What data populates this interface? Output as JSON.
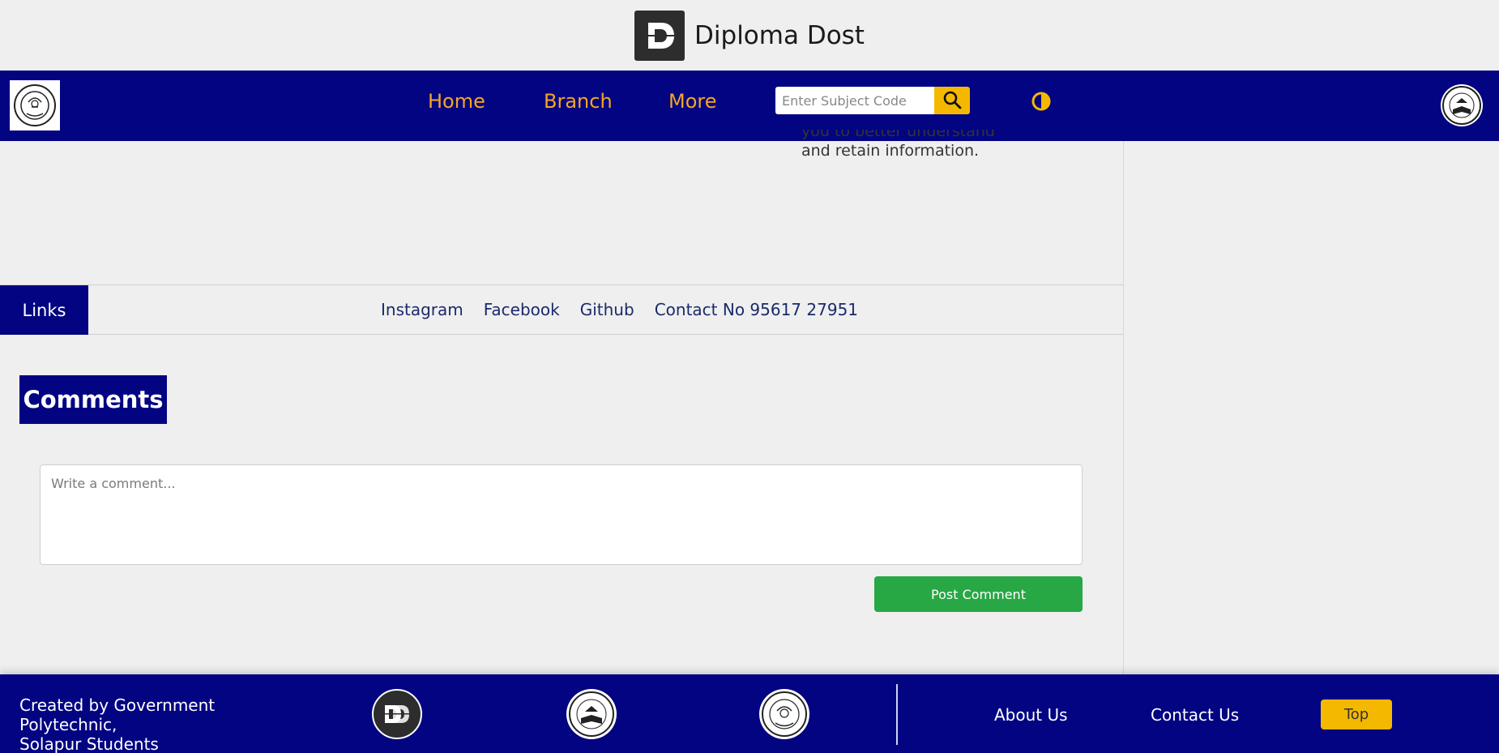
{
  "brand": {
    "title": "Diploma Dost",
    "logo_icon": "diploma-dost-logo"
  },
  "nav": {
    "items": [
      {
        "label": "Home"
      },
      {
        "label": "Branch"
      },
      {
        "label": "More"
      }
    ],
    "search": {
      "placeholder": "Enter Subject Code",
      "value": "",
      "icon": "search-icon"
    },
    "theme_icon": "contrast-icon",
    "accent_color": "#f5a623",
    "bar_color": "#020482"
  },
  "residual": {
    "line1": "you to better understand",
    "line2": "and retain information."
  },
  "links_bar": {
    "tag": "Links",
    "items": [
      {
        "label": "Instagram"
      },
      {
        "label": "Facebook"
      },
      {
        "label": "Github"
      },
      {
        "label": "Contact No 95617 27951"
      }
    ]
  },
  "comments": {
    "heading": "Comments",
    "placeholder": "Write a comment...",
    "value": "",
    "post_label": "Post Comment",
    "post_color": "#28a745"
  },
  "footer": {
    "credit_line1": "Created by Government Polytechnic,",
    "credit_line2": "Solapur Students",
    "about_label": "About Us",
    "contact_label": "Contact Us",
    "top_label": "Top"
  }
}
